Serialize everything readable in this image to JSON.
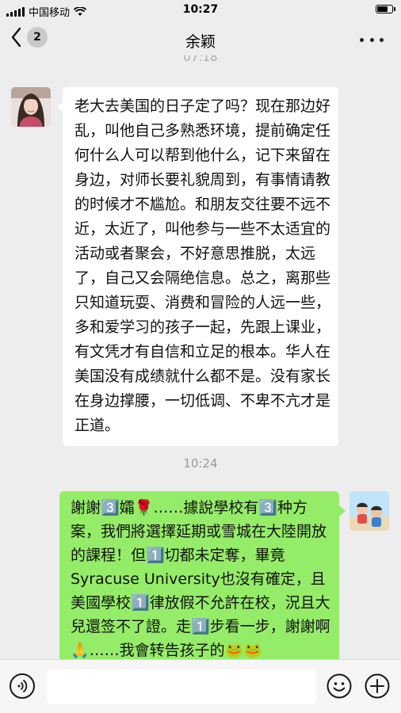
{
  "status_bar": {
    "carrier": "中国移动",
    "time": "10:27"
  },
  "nav": {
    "back_badge": "2",
    "title": "余颖"
  },
  "partial_timestamp": "07:18",
  "messages": [
    {
      "side": "left",
      "text": "老大去美国的日子定了吗？现在那边好乱，叫他自己多熟悉环境，提前确定任何什么人可以帮到他什么，记下来留在身边，对师长要礼貌周到，有事情请教的时候才不尴尬。和朋友交往要不远不近，太近了，叫他参与一些不太适宜的活动或者聚会，不好意思推脱，太远了，自己又会隔绝信息。总之，离那些只知道玩耍、消费和冒险的人远一些，多和爱学习的孩子一起，先跟上课业，有文凭才有自信和立足的根本。华人在美国没有成绩就什么都不是。没有家长在身边撑腰，一切低调、不卑不亢才是正道。"
    },
    {
      "side": "right",
      "text": "謝謝3️⃣孀🌹……據說學校有3️⃣种方案，我們將選擇延期或雪城在大陸開放的課程！但1️⃣切都未定奪，畢竟Syracuse University也沒有確定，且美國學校1️⃣律放假不允許在校，況且大兒還签不了證。走1️⃣步看一步，謝謝啊🙏……我會转告孩子的🐸🐸"
    }
  ],
  "timestamp": "10:24",
  "input": {
    "value": "",
    "placeholder": ""
  },
  "icons": {
    "back": "chevron-left-icon",
    "more": "more-dots-icon",
    "voice": "voice-icon",
    "emoji": "emoji-icon",
    "plus": "plus-icon",
    "wifi": "wifi-icon",
    "signal": "signal-icon",
    "battery": "battery-icon"
  },
  "colors": {
    "background": "#ededed",
    "outgoing_bubble": "#95ec69",
    "incoming_bubble": "#ffffff"
  }
}
